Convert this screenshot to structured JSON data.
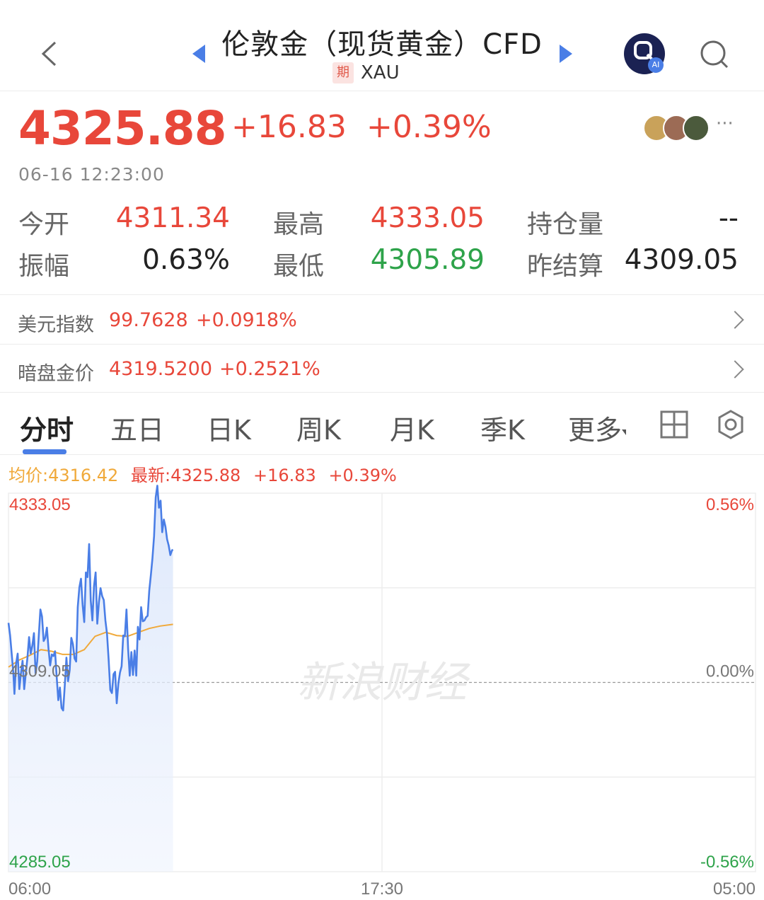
{
  "header": {
    "title": "伦敦金（现货黄金）CFD",
    "badge": "期",
    "symbol": "XAU",
    "ai_badge": "AI"
  },
  "quote": {
    "price": "4325.88",
    "change": "+16.83",
    "change_pct": "+0.39%",
    "timestamp": "06-16 12:23:00",
    "more": "···"
  },
  "stats": [
    {
      "label": "今开",
      "value": "4311.34",
      "tone": "red"
    },
    {
      "label": "最高",
      "value": "4333.05",
      "tone": "red"
    },
    {
      "label": "持仓量",
      "value": "--",
      "tone": "dark"
    },
    {
      "label": "振幅",
      "value": "0.63%",
      "tone": "dark"
    },
    {
      "label": "最低",
      "value": "4305.89",
      "tone": "green"
    },
    {
      "label": "昨结算",
      "value": "4309.05",
      "tone": "dark"
    }
  ],
  "related": [
    {
      "label": "美元指数",
      "value": "99.7628",
      "change": "+0.0918%"
    },
    {
      "label": "暗盘金价",
      "value": "4319.5200",
      "change": "+0.2521%"
    }
  ],
  "tabs": [
    "分时",
    "五日",
    "日K",
    "周K",
    "月K",
    "季K",
    "更多"
  ],
  "active_tab": "分时",
  "legend": {
    "avg": "均价:4316.42",
    "latest": "最新:4325.88",
    "change": "+16.83",
    "change_pct": "+0.39%"
  },
  "watermark": "新浪财经",
  "colors": {
    "up": "#e8473a",
    "down": "#2ea34a",
    "price_line": "#4a7ee6",
    "avg_line": "#f0a93a",
    "accent": "#4a7ee6"
  },
  "chart_data": {
    "type": "line",
    "note": "intraday minute chart; series values estimated from the image",
    "y_ticks_left": [
      "4333.05",
      "4309.05",
      "4285.05"
    ],
    "y_ticks_right": [
      "0.56%",
      "0.00%",
      "-0.56%"
    ],
    "x_ticks": [
      "06:00",
      "17:30",
      "05:00"
    ],
    "ylim": [
      4285.05,
      4333.05
    ],
    "baseline": 4309.05,
    "session_minutes": 1380,
    "series": [
      {
        "name": "最新",
        "color": "#4a7ee6",
        "x": [
          0,
          3,
          6,
          9,
          11,
          14,
          17,
          20,
          23,
          26,
          29,
          32,
          35,
          38,
          41,
          44,
          47,
          50,
          53,
          56,
          59,
          62,
          65,
          68,
          71,
          74,
          77,
          80,
          83,
          86,
          89,
          92,
          95,
          98,
          101,
          104,
          107,
          110,
          113,
          116,
          119,
          122,
          125,
          128,
          131,
          134,
          137,
          140,
          143,
          146,
          149,
          152,
          155,
          158,
          161,
          164,
          167,
          170,
          173,
          176,
          179,
          182,
          185,
          188,
          191,
          194,
          197,
          200,
          203,
          206,
          209,
          212,
          215,
          218,
          221,
          224,
          227,
          230,
          233,
          236,
          239,
          242,
          245,
          248,
          251,
          254,
          257,
          260,
          263,
          266,
          269,
          272,
          275,
          278,
          281,
          284,
          287,
          290,
          293,
          296,
          299,
          302,
          304
        ],
        "values": [
          4316.6,
          4315.0,
          4312.6,
          4310.2,
          4307.6,
          4311.4,
          4312.7,
          4308.2,
          4310.2,
          4311.8,
          4308.2,
          4310.2,
          4312.2,
          4314.8,
          4312.7,
          4313.7,
          4315.3,
          4310.2,
          4311.7,
          4315.1,
          4318.3,
          4317.4,
          4314.3,
          4314.7,
          4316.0,
          4313.3,
          4311.2,
          4312.6,
          4312.4,
          4313.0,
          4309.8,
          4306.8,
          4308.4,
          4305.8,
          4305.5,
          4308.7,
          4312.2,
          4309.2,
          4310.6,
          4314.7,
          4313.9,
          4312.1,
          4311.7,
          4318.6,
          4321.1,
          4322.2,
          4318.9,
          4316.7,
          4323.0,
          4322.4,
          4326.6,
          4319.4,
          4316.9,
          4321.3,
          4323.0,
          4316.5,
          4319.2,
          4321.0,
          4320.0,
          4319.5,
          4316.9,
          4315.2,
          4311.9,
          4308.1,
          4307.7,
          4310.1,
          4310.4,
          4306.4,
          4308.9,
          4310.3,
          4311.1,
          4315.0,
          4314.9,
          4318.3,
          4313.3,
          4309.9,
          4312.9,
          4310.0,
          4313.1,
          4309.9,
          4316.1,
          4314.5,
          4318.6,
          4316.8,
          4316.9,
          4317.3,
          4317.5,
          4320.7,
          4322.7,
          4324.8,
          4327.6,
          4332.5,
          4334.0,
          4331.2,
          4332.1,
          4328.1,
          4329.7,
          4328.8,
          4327.2,
          4326.4,
          4325.2,
          4325.8,
          4325.88
        ]
      },
      {
        "name": "均价",
        "color": "#f0a93a",
        "x": [
          0,
          20,
          40,
          60,
          80,
          100,
          120,
          140,
          160,
          180,
          200,
          220,
          240,
          260,
          280,
          304
        ],
        "values": [
          4311.0,
          4311.9,
          4312.5,
          4313.2,
          4313.0,
          4312.6,
          4312.6,
          4313.2,
          4314.9,
          4315.4,
          4315.0,
          4314.9,
          4315.4,
          4315.9,
          4316.2,
          4316.42
        ]
      }
    ]
  }
}
